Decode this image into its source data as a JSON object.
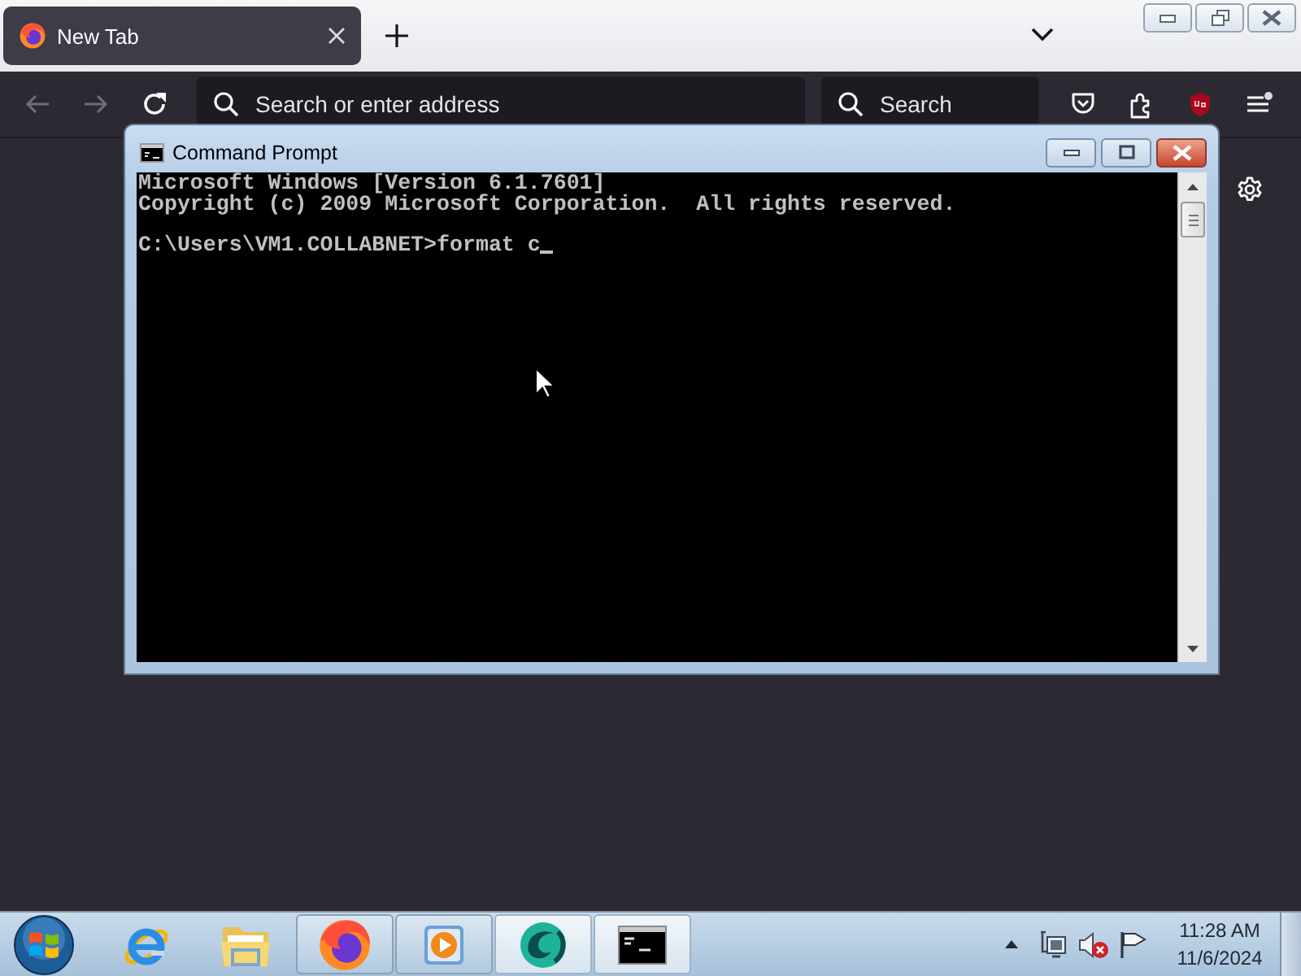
{
  "browser": {
    "tabs": [
      {
        "title": "New Tab",
        "selected": true
      }
    ],
    "toolbar": {
      "back": {
        "disabled": true
      },
      "forward": {
        "disabled": true
      },
      "address_bar": {
        "placeholder": "Search or enter address"
      },
      "search_bar": {
        "placeholder": "Search"
      }
    }
  },
  "console_window": {
    "title": "Command Prompt",
    "output_lines": [
      "Microsoft Windows [Version 6.1.7601]",
      "Copyright (c) 2009 Microsoft Corporation.  All rights reserved."
    ],
    "prompt_line": "C:\\Users\\VM1.COLLABNET>format c"
  },
  "taskbar": {
    "buttons": [
      {
        "kind": "e-logo",
        "running": false,
        "highlighted": false
      },
      {
        "kind": "folder",
        "running": false,
        "highlighted": false
      },
      {
        "kind": "fox-globe",
        "running": true,
        "highlighted": false
      },
      {
        "kind": "play",
        "running": true,
        "highlighted": false
      },
      {
        "kind": "swirl-orb",
        "running": true,
        "highlighted": true
      },
      {
        "kind": "console",
        "running": true,
        "highlighted": true
      }
    ],
    "tray": {
      "volume_muted": true
    },
    "clock": {
      "time": "11:28 AM",
      "date": "11/6/2024"
    }
  }
}
